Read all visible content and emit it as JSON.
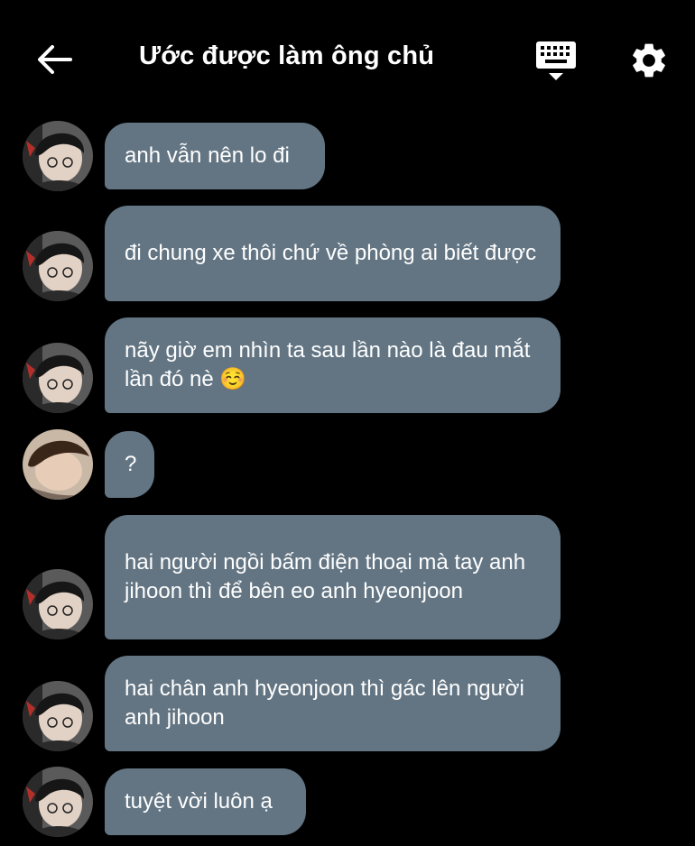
{
  "header": {
    "title": "Ước được làm ông chủ",
    "back_icon": "arrow-left-icon",
    "keyboard_icon": "keyboard-icon",
    "settings_icon": "gear-icon"
  },
  "colors": {
    "background": "#000000",
    "bubble": "#637583",
    "text": "#ffffff"
  },
  "messages": [
    {
      "avatar": "avatar-a",
      "text": "anh vẫn nên lo đi"
    },
    {
      "avatar": "avatar-a",
      "text": "đi chung xe thôi chứ về phòng ai biết được"
    },
    {
      "avatar": "avatar-a",
      "text": "nãy giờ em nhìn ta sau lần nào là đau mắt lần đó nè ☺️"
    },
    {
      "avatar": "avatar-b",
      "text": "?"
    },
    {
      "avatar": "avatar-a",
      "text": "hai người ngồi bấm điện thoại mà tay anh jihoon thì để bên eo anh hyeonjoon"
    },
    {
      "avatar": "avatar-a",
      "text": "hai chân anh hyeonjoon thì gác lên người anh jihoon"
    },
    {
      "avatar": "avatar-a",
      "text": "tuyệt vời luôn ạ"
    }
  ]
}
